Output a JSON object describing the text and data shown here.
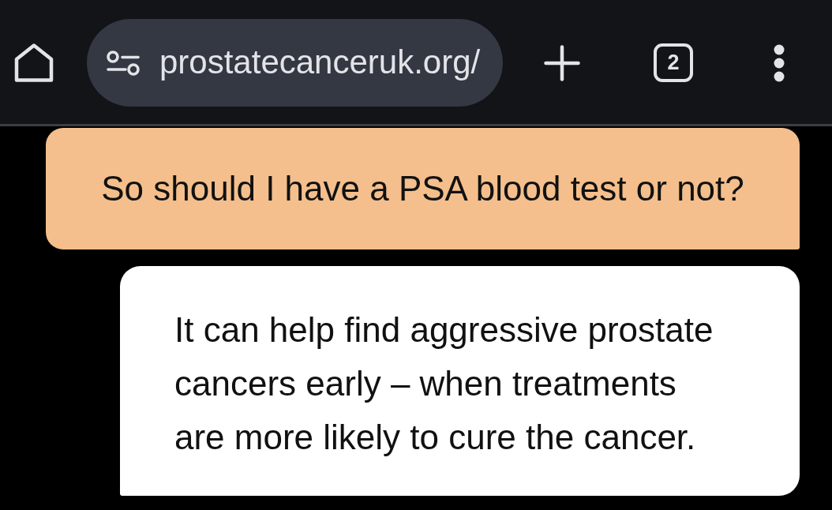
{
  "browser_bar": {
    "url": "prostatecanceruk.org/",
    "tab_count": "2"
  },
  "messages": [
    {
      "kind": "question",
      "lines": [
        "So should I have a PSA blood test or not?"
      ]
    },
    {
      "kind": "answer",
      "lines": [
        "It can help find aggressive prostate",
        "cancers early – when treatments",
        "are more likely to cure the cancer."
      ]
    }
  ]
}
